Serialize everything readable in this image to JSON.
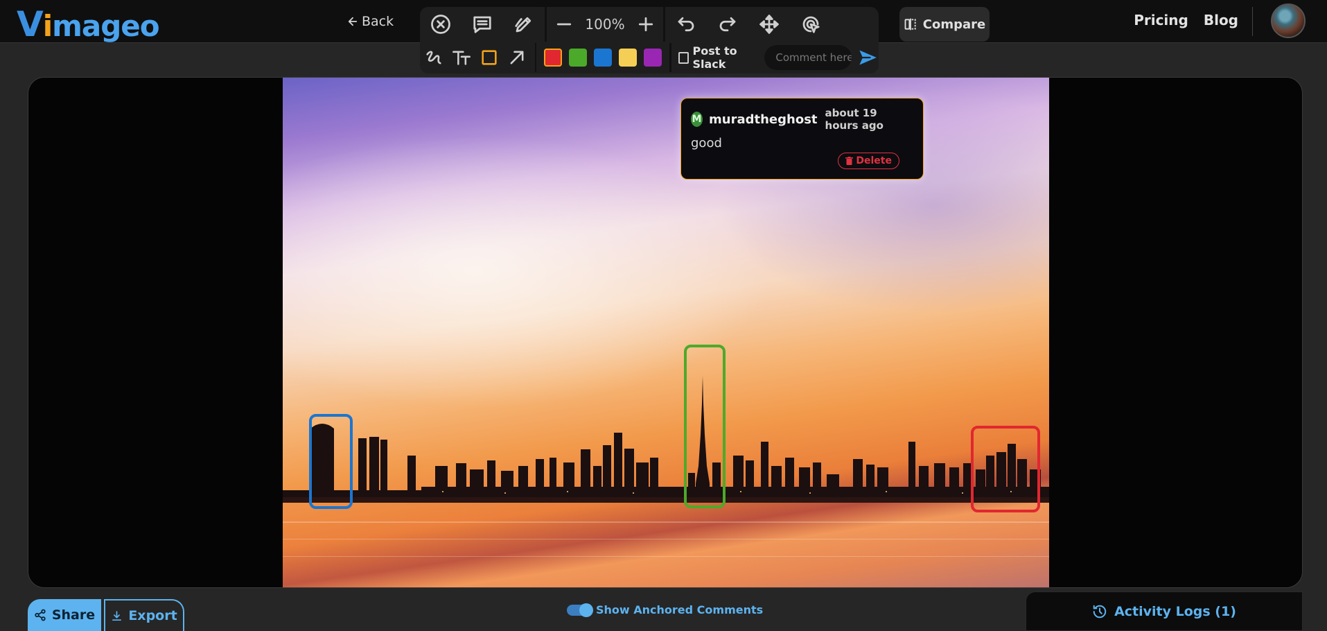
{
  "header": {
    "logo_v": "V",
    "logo_i": "i",
    "logo_rest": "mageo",
    "back_label": "Back",
    "nav": [
      "Pricing",
      "Blog"
    ]
  },
  "toolbar": {
    "zoom": "100%",
    "post_to_slack_label": "Post to Slack",
    "comment_placeholder": "Comment here",
    "colors": [
      "#e1272f",
      "#4caa2a",
      "#1b76d1",
      "#f5cf55",
      "#9a27b3"
    ],
    "selected_color": "#e1272f",
    "compare_label": "Compare",
    "icons": [
      "cancel-icon",
      "comment-icon",
      "draw-icon",
      "zoom-out-icon",
      "zoom-in-icon",
      "undo-icon",
      "redo-icon",
      "move-icon",
      "select-icon",
      "freehand-icon",
      "text-icon",
      "rectangle-icon",
      "arrow-icon",
      "send-icon"
    ]
  },
  "annotations": [
    {
      "color": "#1b76d1"
    },
    {
      "color": "#4caa2a"
    },
    {
      "color": "#e1272f"
    }
  ],
  "comment": {
    "avatar_letter": "M",
    "user": "muradtheghost",
    "time": "about 19 hours ago",
    "text": "good",
    "delete_label": "Delete"
  },
  "footer": {
    "share_label": "Share",
    "export_label": "Export",
    "toggle_label": "Show Anchored Comments",
    "toggle_on": true,
    "activity_label": "Activity Logs (1)"
  }
}
